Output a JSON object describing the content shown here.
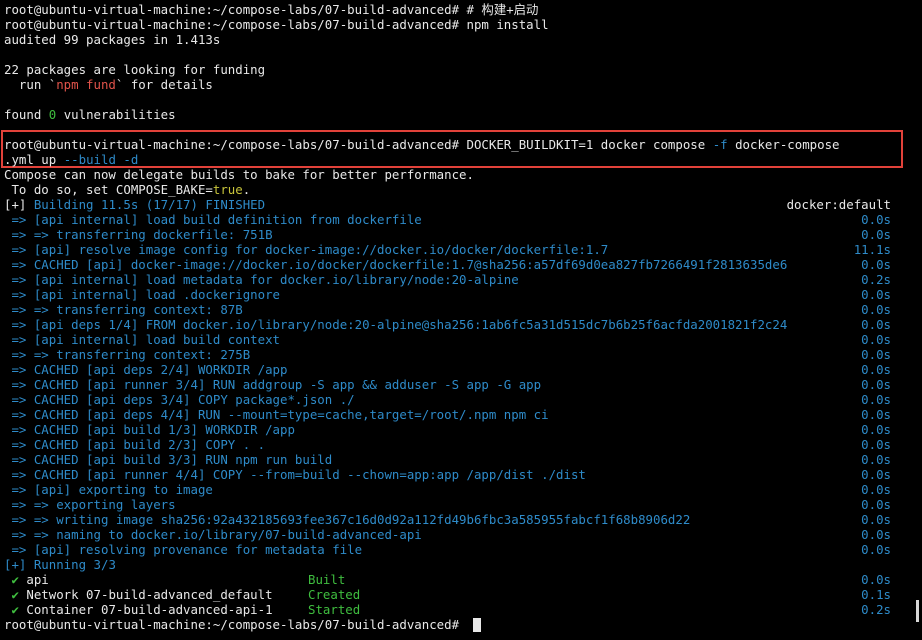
{
  "colors": {
    "background": "#000000",
    "text": "#e8e8e8",
    "blue": "#2e8bc9",
    "red": "#e0534a",
    "green": "#3fbe3f",
    "highlight_box": "#e2423a"
  },
  "prompt": "root@ubuntu-virtual-machine:~/compose-labs/07-build-advanced#",
  "lines": {
    "l0": "root@ubuntu-virtual-machine:~/compose-labs/07-build-advanced# # 构建+启动",
    "l1": "root@ubuntu-virtual-machine:~/compose-labs/07-build-advanced# npm install",
    "l2": "audited 99 packages in 1.413s",
    "l4": "22 packages are looking for funding",
    "l5a": "  run `",
    "l5b": "npm fund",
    "l5c": "` for details",
    "l7a": "found ",
    "l7b": "0",
    "l7c": " vulnerabilities",
    "cmd1a": "root@ubuntu-virtual-machine:~/compose-labs/07-build-advanced# DOCKER_BUILDKIT=1 docker compose ",
    "cmd1b": "-f",
    "cmd1c": " docker-compose",
    "cmd2a": ".yml up ",
    "cmd2b": "--build",
    "cmd2c": " ",
    "cmd2d": "-d",
    "bake1": "Compose can now delegate builds to bake for better performance.",
    "bake2a": " To do so, set COMPOSE_BAKE=",
    "bake2b": "true",
    "bake2c": ".",
    "build_a": "[+] ",
    "build_b": "Building 11.5s (17/17) FINISHED",
    "build_right": "docker:default"
  },
  "build_steps": [
    {
      "text": " => [api internal] load build definition from dockerfile",
      "time": "0.0s"
    },
    {
      "text": " => => transferring dockerfile: 751B",
      "time": "0.0s"
    },
    {
      "text": " => [api] resolve image config for docker-image://docker.io/docker/dockerfile:1.7",
      "time": "11.1s"
    },
    {
      "text": " => CACHED [api] docker-image://docker.io/docker/dockerfile:1.7@sha256:a57df69d0ea827fb7266491f2813635de6",
      "time": "0.0s"
    },
    {
      "text": " => [api internal] load metadata for docker.io/library/node:20-alpine",
      "time": "0.2s"
    },
    {
      "text": " => [api internal] load .dockerignore",
      "time": "0.0s"
    },
    {
      "text": " => => transferring context: 87B",
      "time": "0.0s"
    },
    {
      "text": " => [api deps 1/4] FROM docker.io/library/node:20-alpine@sha256:1ab6fc5a31d515dc7b6b25f6acfda2001821f2c24",
      "time": "0.0s"
    },
    {
      "text": " => [api internal] load build context",
      "time": "0.0s"
    },
    {
      "text": " => => transferring context: 275B",
      "time": "0.0s"
    },
    {
      "text": " => CACHED [api deps 2/4] WORKDIR /app",
      "time": "0.0s"
    },
    {
      "text": " => CACHED [api runner 3/4] RUN addgroup -S app && adduser -S app -G app",
      "time": "0.0s"
    },
    {
      "text": " => CACHED [api deps 3/4] COPY package*.json ./",
      "time": "0.0s"
    },
    {
      "text": " => CACHED [api deps 4/4] RUN --mount=type=cache,target=/root/.npm npm ci",
      "time": "0.0s"
    },
    {
      "text": " => CACHED [api build 1/3] WORKDIR /app",
      "time": "0.0s"
    },
    {
      "text": " => CACHED [api build 2/3] COPY . .",
      "time": "0.0s"
    },
    {
      "text": " => CACHED [api build 3/3] RUN npm run build",
      "time": "0.0s"
    },
    {
      "text": " => CACHED [api runner 4/4] COPY --from=build --chown=app:app /app/dist ./dist",
      "time": "0.0s"
    },
    {
      "text": " => [api] exporting to image",
      "time": "0.0s"
    },
    {
      "text": " => => exporting layers",
      "time": "0.0s"
    },
    {
      "text": " => => writing image sha256:92a432185693fee367c16d0d92a112fd49b6fbc3a585955fabcf1f68b8906d22",
      "time": "0.0s"
    },
    {
      "text": " => => naming to docker.io/library/07-build-advanced-api",
      "time": "0.0s"
    },
    {
      "text": " => [api] resolving provenance for metadata file",
      "time": "0.0s"
    }
  ],
  "running": {
    "prefix": "[+] ",
    "label": "Running 3/3"
  },
  "containers": [
    {
      "check": " ✔",
      "name": " api",
      "status": "Built",
      "time": "0.0s"
    },
    {
      "check": " ✔",
      "name": " Network 07-build-advanced_default",
      "status": "Created",
      "time": "0.1s"
    },
    {
      "check": " ✔",
      "name": " Container 07-build-advanced-api-1",
      "status": "Started",
      "time": "0.2s"
    }
  ],
  "final_prompt": "root@ubuntu-virtual-machine:~/compose-labs/07-build-advanced# "
}
